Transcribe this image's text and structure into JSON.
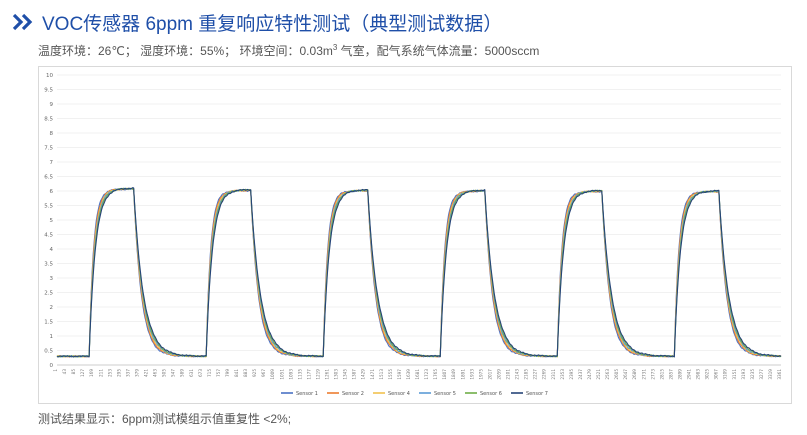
{
  "header": {
    "title": "VOC传感器 6ppm 重复响应特性测试（典型测试数据）",
    "icon": "double-chevron-icon",
    "accent_color": "#1f4fa8"
  },
  "conditions": {
    "prefix": "温度环境：26℃；  湿度环境：55%；  环境空间：0.03m",
    "sup": "3",
    "suffix": " 气室，配气系统气体流量：5000sccm"
  },
  "footer": {
    "text": "测试结果显示：6ppm测试模组示值重复性 <2%;"
  },
  "chart_data": {
    "type": "line",
    "ylim": [
      0,
      10
    ],
    "yticks": [
      "0",
      "0.5",
      "1",
      "1.5",
      "2",
      "2.5",
      "3",
      "3.5",
      "4",
      "4.5",
      "5",
      "5.5",
      "6",
      "6.5",
      "7",
      "7.5",
      "8",
      "8.5",
      "9",
      "9.5",
      "10"
    ],
    "grid": true,
    "legend_position": "bottom",
    "baseline": 0.3,
    "plateau": 6.0,
    "cycles": [
      {
        "on": 31,
        "off": 74,
        "peak": 6.08
      },
      {
        "on": 144,
        "off": 187,
        "peak": 6.03
      },
      {
        "on": 257,
        "off": 300,
        "peak": 6.02
      },
      {
        "on": 370,
        "off": 413,
        "peak": 6.01
      },
      {
        "on": 483,
        "off": 526,
        "peak": 6.0
      },
      {
        "on": 596,
        "off": 639,
        "peak": 5.99
      }
    ],
    "x_count": 700,
    "xticks": [
      "1",
      "43",
      "85",
      "127",
      "169",
      "211",
      "253",
      "295",
      "337",
      "379",
      "421",
      "463",
      "505",
      "547",
      "589",
      "631",
      "673",
      "715",
      "757",
      "799",
      "841",
      "883",
      "925",
      "967",
      "1009",
      "1051",
      "1093",
      "1135",
      "1177",
      "1219",
      "1261",
      "1303",
      "1345",
      "1387",
      "1429",
      "1471",
      "1513",
      "1555",
      "1597",
      "1639",
      "1681",
      "1723",
      "1765",
      "1807",
      "1849",
      "1891",
      "1933",
      "1975",
      "2017",
      "2059",
      "2101",
      "2143",
      "2185",
      "2227",
      "2269",
      "2311",
      "2353",
      "2395",
      "2437",
      "2479",
      "2521",
      "2563",
      "2605",
      "2647",
      "2689",
      "2731",
      "2773",
      "2815",
      "2857",
      "2899",
      "2941",
      "2983",
      "3025",
      "3067",
      "3109",
      "3151",
      "3193",
      "3235",
      "3277",
      "3319",
      "3361"
    ],
    "series": [
      {
        "name": "Sensor 1",
        "color": "#4a72c4"
      },
      {
        "name": "Sensor 2",
        "color": "#ed7d31"
      },
      {
        "name": "Sensor 4",
        "color": "#f2c14e"
      },
      {
        "name": "Sensor 5",
        "color": "#5b9bd5"
      },
      {
        "name": "Sensor 6",
        "color": "#70ad47"
      },
      {
        "name": "Sensor 7",
        "color": "#264478"
      }
    ]
  }
}
